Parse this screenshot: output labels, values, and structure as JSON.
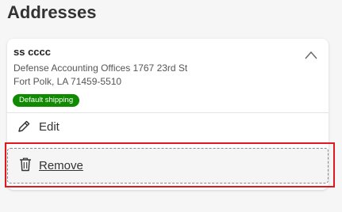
{
  "page": {
    "title": "Addresses"
  },
  "address_card": {
    "name": "ss cccc",
    "line1": "Defense Accounting Offices 1767 23rd St",
    "line2": "Fort Polk, LA 71459-5510",
    "badge": "Default shipping",
    "badge_color": "#108a00",
    "collapse_icon": "chevron-up-icon"
  },
  "actions": {
    "edit_label": "Edit",
    "edit_icon": "pencil-icon",
    "remove_label": "Remove",
    "remove_icon": "trash-icon"
  },
  "highlight_color": "#e0191e"
}
